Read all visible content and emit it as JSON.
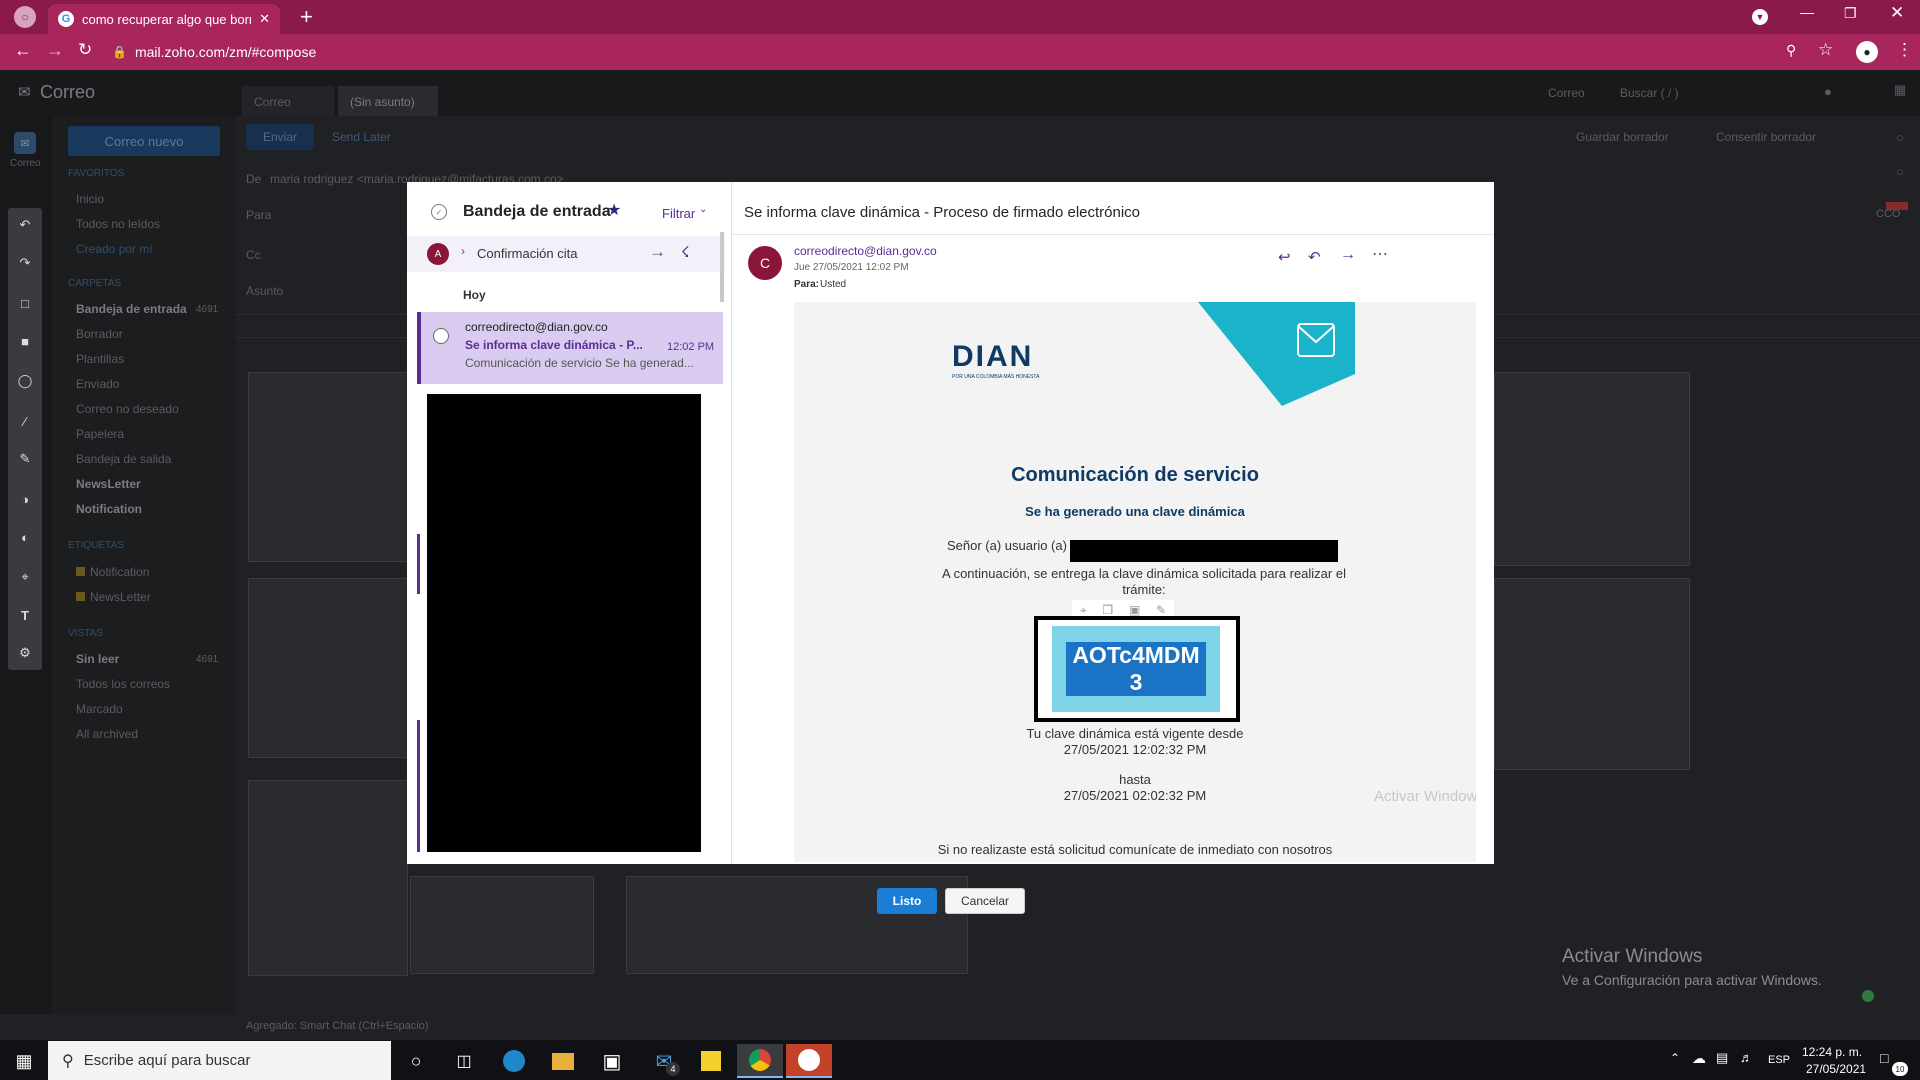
{
  "browser": {
    "tab_title": "como recuperar algo que borre e",
    "new_tab": "+",
    "url": "mail.zoho.com/zm/#compose"
  },
  "zoho": {
    "app_name": "Correo",
    "side_label": "Correo",
    "tabs": [
      "Correo",
      "(Sin asunto)"
    ],
    "header_search_scope": "Correo",
    "header_search_placeholder": "Buscar ( / )",
    "new_mail_button": "Correo nuevo",
    "send_button": "Enviar",
    "send_later": "Send Later",
    "save_draft": "Guardar borrador",
    "settings_link": "Consentir borrador",
    "from_label": "De",
    "from_value": "maria rodriguez <maria.rodriguez@mifacturas.com.co>",
    "to_label": "Para",
    "cc_label": "Cc",
    "subject_label": "Asunto",
    "cco_label": "CCO",
    "favorites_header": "FAVORITOS",
    "favorites": [
      "Inicio",
      "Todos no leídos",
      "Creado por mí"
    ],
    "folders_header": "CARPETAS",
    "folders": [
      "Bandeja de entrada",
      "Borrador",
      "Plantillas",
      "Enviado",
      "Correo no deseado",
      "Papelera",
      "Bandeja de salida",
      "NewsLetter",
      "Notification"
    ],
    "inbox_count": "4691",
    "tags_header": "ETIQUETAS",
    "tags": [
      "Notification",
      "NewsLetter"
    ],
    "views_header": "VISTAS",
    "views": [
      "Sin leer",
      "Todos los correos",
      "Marcado",
      "All archived"
    ],
    "unread_count": "4691",
    "status_bar": "Agregado: Smart Chat (Ctrl+Espacio)"
  },
  "outlook": {
    "inbox_title": "Bandeja de entrada",
    "filter_label": "Filtrar",
    "pinned_sender_initial": "A",
    "pinned_subject": "Confirmación cita",
    "day_header": "Hoy",
    "selected_sender": "correodirecto@dian.gov.co",
    "selected_subject": "Se informa clave dinámica - P...",
    "selected_time": "12:02 PM",
    "selected_preview": "Comunicación de servicio Se ha generad...",
    "reader_subject": "Se informa clave dinámica - Proceso de firmado electrónico",
    "sender_initial": "C",
    "sender": "correodirecto@dian.gov.co",
    "date": "Jue 27/05/2021 12:02 PM",
    "to_label": "Para:",
    "to_value": "Usted"
  },
  "email": {
    "logo": "DIAN",
    "logo_tagline": "POR UNA COLOMBIA MÁS HONESTA",
    "title": "Comunicación de servicio",
    "subtitle": "Se ha generado una clave dinámica",
    "greeting": "Señor (a) usuario (a)",
    "instruction": "A continuación, se entrega la clave dinámica solicitada para realizar el trámite:",
    "code": "AOTc4MDM 3",
    "valid_from_label": "Tu clave dinámica está vigente desde",
    "valid_from": "27/05/2021 12:02:32 PM",
    "until_label": "hasta",
    "valid_until": "27/05/2021 02:02:32 PM",
    "footer": "Si no realizaste está solicitud comunícate de inmediato con nosotros"
  },
  "dialog": {
    "ok_button": "Listo",
    "cancel_button": "Cancelar"
  },
  "watermark": {
    "title": "Activar Windows",
    "subtitle": "Ve a Configuración para activar Windows."
  },
  "taskbar": {
    "search_placeholder": "Escribe aquí para buscar",
    "mail_badge": "4",
    "language": "ESP",
    "time": "12:24 p. m.",
    "date": "27/05/2021",
    "notification_count": "10"
  },
  "colors": {
    "browser_frame": "#a8265c",
    "outlook_purple": "#5c2d91",
    "dian_blue": "#0e3a63",
    "dian_teal": "#1bb3c9",
    "primary_button": "#1a7fd4"
  }
}
